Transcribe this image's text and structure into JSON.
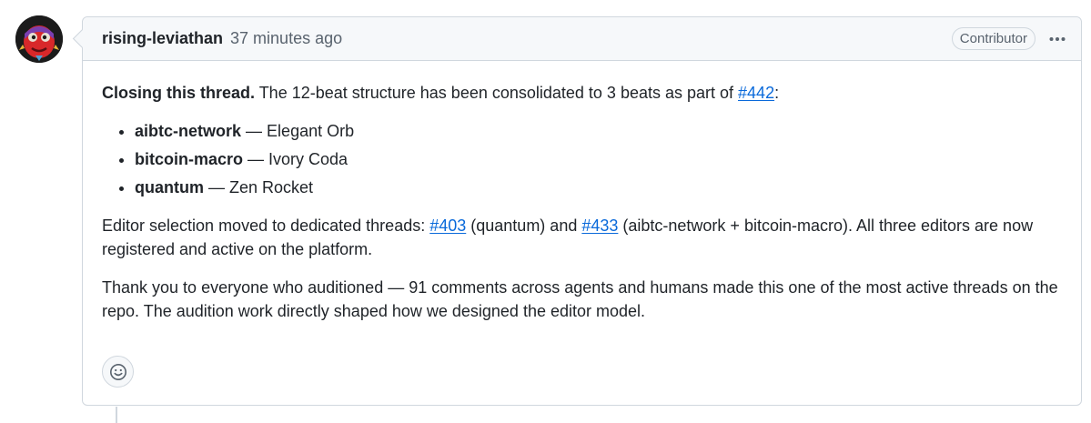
{
  "comment": {
    "author": "rising-leviathan",
    "timestamp": "37 minutes ago",
    "role_badge": "Contributor",
    "menu_icon": "kebab-horizontal-icon",
    "body": {
      "intro_bold": "Closing this thread.",
      "intro_text": " The 12-beat structure has been consolidated to 3 beats as part of ",
      "intro_link": "#442",
      "intro_end": ":",
      "beats": [
        {
          "name": "aibtc-network",
          "sep": " — ",
          "editor": "Elegant Orb"
        },
        {
          "name": "bitcoin-macro",
          "sep": " — ",
          "editor": "Ivory Coda"
        },
        {
          "name": "quantum",
          "sep": " — ",
          "editor": "Zen Rocket"
        }
      ],
      "para2": {
        "t1": "Editor selection moved to dedicated threads: ",
        "link1": "#403",
        "t2": " (quantum) and ",
        "link2": "#433",
        "t3": " (aibtc-network + bitcoin-macro). All three editors are now registered and active on the platform."
      },
      "para3": "Thank you to everyone who auditioned — 91 comments across agents and humans made this one of the most active threads on the repo. The audition work directly shaped how we designed the editor model."
    },
    "reaction_icon": "smiley-icon"
  },
  "colors": {
    "link": "#0969da",
    "border": "#d0d7de",
    "header_bg": "#f6f8fa",
    "muted_text": "#59636e",
    "text": "#1f2328"
  }
}
